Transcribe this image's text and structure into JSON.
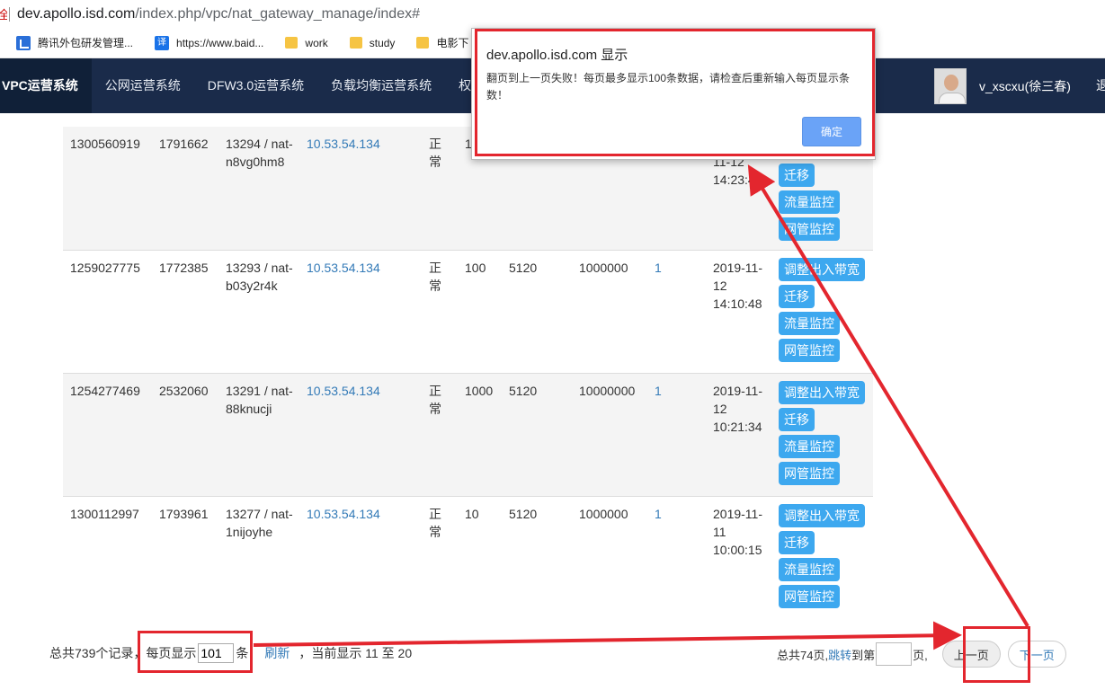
{
  "browser": {
    "warn_glyph": "全",
    "url_host": "dev.apollo.isd.com",
    "url_path": "/index.php/vpc/nat_gateway_manage/index#",
    "bookmarks": [
      {
        "label": "腾讯外包研发管理...",
        "icon": "tencent-icon"
      },
      {
        "label": "https://www.baid...",
        "icon": "translate-icon",
        "glyph": "译"
      },
      {
        "label": "work",
        "icon": "folder-icon"
      },
      {
        "label": "study",
        "icon": "folder-icon"
      },
      {
        "label": "电影下",
        "icon": "folder-icon"
      }
    ]
  },
  "nav": {
    "items": [
      "VPC运营系统",
      "公网运营系统",
      "DFW3.0运营系统",
      "负载均衡运营系统",
      "权"
    ],
    "user": "v_xscxu(徐三春)",
    "logout": "退"
  },
  "table": {
    "rows": [
      {
        "app_id": "1300560919",
        "uin": "1791662",
        "name": "13294 / nat-n8vg0hm8",
        "ip": "10.53.54.134",
        "status": "正常",
        "bandwidth": "1",
        "conn": "",
        "max": "",
        "count": "",
        "time": "2019-11-12 14:23:45"
      },
      {
        "app_id": "1259027775",
        "uin": "1772385",
        "name": "13293 / nat-b03y2r4k",
        "ip": "10.53.54.134",
        "status": "正常",
        "bandwidth": "100",
        "conn": "5120",
        "max": "1000000",
        "count": "1",
        "time": "2019-11-12 14:10:48"
      },
      {
        "app_id": "1254277469",
        "uin": "2532060",
        "name": "13291 / nat-88knucji",
        "ip": "10.53.54.134",
        "status": "正常",
        "bandwidth": "1000",
        "conn": "5120",
        "max": "10000000",
        "count": "1",
        "time": "2019-11-12 10:21:34"
      },
      {
        "app_id": "1300112997",
        "uin": "1793961",
        "name": "13277 / nat-1nijoyhe",
        "ip": "10.53.54.134",
        "status": "正常",
        "bandwidth": "10",
        "conn": "5120",
        "max": "1000000",
        "count": "1",
        "time": "2019-11-11 10:00:15"
      }
    ],
    "row0_time_visible": "11-12 14:23:45",
    "ops": [
      "调整出入带宽",
      "迁移",
      "流量监控",
      "网管监控"
    ]
  },
  "footer": {
    "total_text": "总共739个记录，",
    "perpage_prefix": "每页显示",
    "perpage_value": "101",
    "perpage_suffix": "条",
    "refresh": "刷新",
    "current_text": "，当前显示 11 至 20",
    "total_pages": "总共74页,",
    "jump_link": "跳转",
    "jump_to": "到第",
    "page_suffix": "页,",
    "prev": "上一页",
    "next": "下一页"
  },
  "dialog": {
    "title": "dev.apollo.isd.com 显示",
    "message": "翻页到上一页失败！每页最多显示100条数据，请检查后重新输入每页显示条数！",
    "ok": "确定"
  },
  "colors": {
    "nav_bg": "#1a2b4a",
    "op_button": "#3da8ef",
    "annotation_red": "#e3262e",
    "link": "#337ab7"
  }
}
